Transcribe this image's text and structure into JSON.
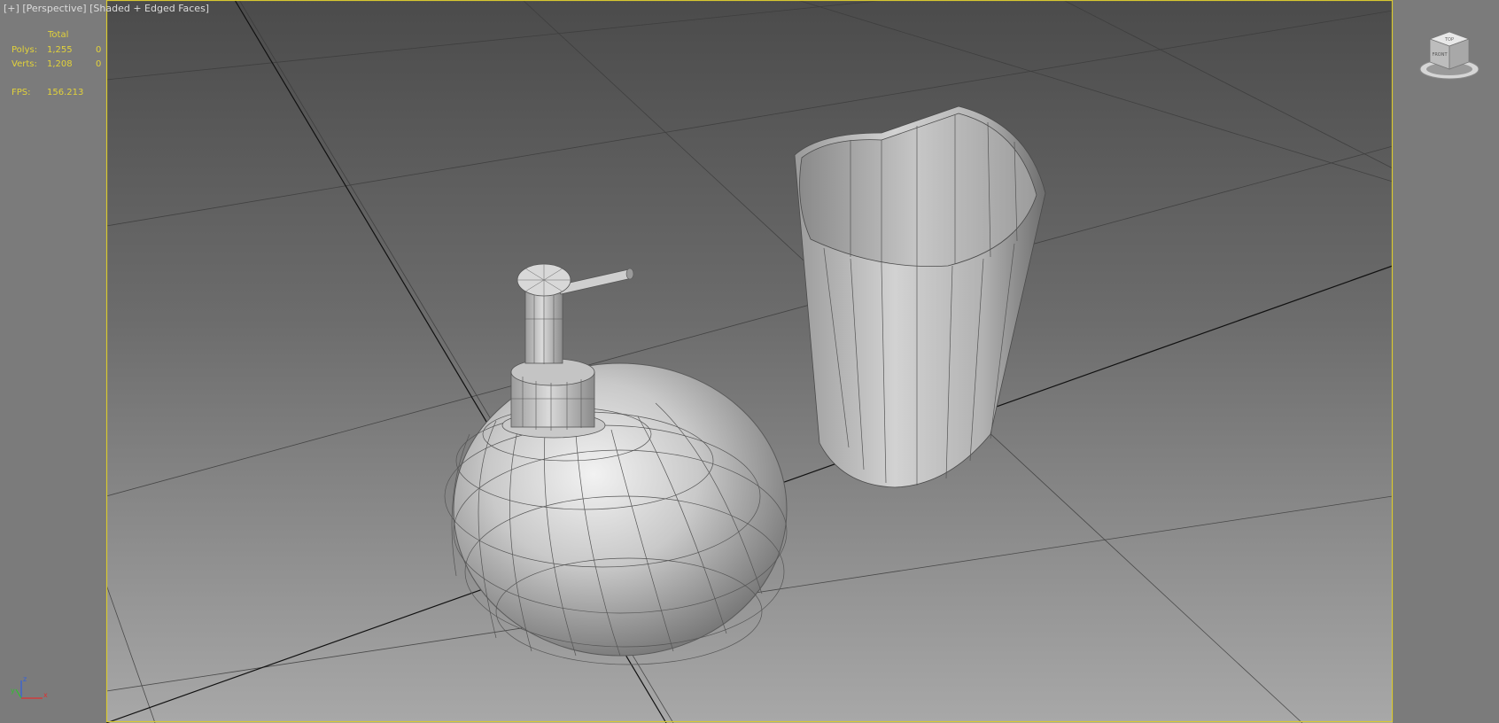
{
  "viewport": {
    "label_parts": [
      "[+]",
      "[Perspective]",
      "[Shaded + Edged Faces]"
    ],
    "active_border_color": "#d8c830",
    "background_top_color": "#4e4e4e",
    "background_bottom_color": "#a6a6a6",
    "side_panel_color": "#7b7b7b"
  },
  "stats": {
    "header": "Total",
    "polys_label": "Polys:",
    "polys_value": "1,255",
    "polys_selected": "0",
    "verts_label": "Verts:",
    "verts_value": "1,208",
    "verts_selected": "0",
    "fps_label": "FPS:",
    "fps_value": "156.213",
    "text_color": "#e2d23a"
  },
  "viewcube": {
    "faces": [
      "TOP",
      "FRONT"
    ],
    "icon": "viewcube-icon"
  },
  "axis_tripod": {
    "labels": [
      "z",
      "y",
      "x"
    ],
    "colors": {
      "x": "#e03030",
      "y": "#30c030",
      "z": "#3060e0"
    }
  },
  "scene_objects": [
    "soap-dispenser",
    "cup"
  ]
}
